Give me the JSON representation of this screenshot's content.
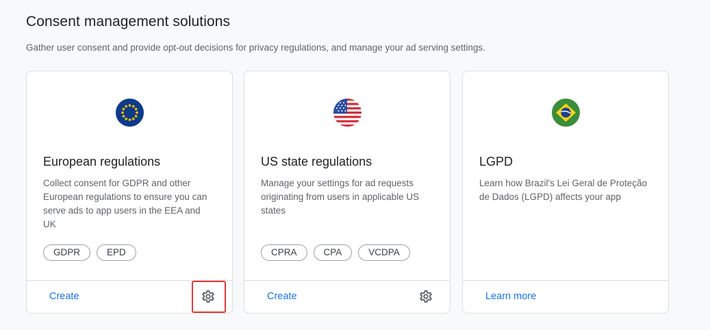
{
  "header": {
    "title": "Consent management solutions",
    "subtitle": "Gather user consent and provide opt-out decisions for privacy regulations, and manage your ad serving settings."
  },
  "cards": [
    {
      "flag_icon": "eu-flag-icon",
      "title": "European regulations",
      "description": "Collect consent for GDPR and other European regulations to ensure you can serve ads to app users in the EEA and UK",
      "chips": [
        "GDPR",
        "EPD"
      ],
      "action_label": "Create",
      "has_settings": true,
      "settings_highlighted": true
    },
    {
      "flag_icon": "us-flag-icon",
      "title": "US state regulations",
      "description": "Manage your settings for ad requests originating from users in applicable US states",
      "chips": [
        "CPRA",
        "CPA",
        "VCDPA"
      ],
      "action_label": "Create",
      "has_settings": true,
      "settings_highlighted": false
    },
    {
      "flag_icon": "brazil-flag-icon",
      "title": "LGPD",
      "description": "Learn how Brazil's Lei Geral de Proteção de Dados (LGPD) affects your app",
      "chips": [],
      "action_label": "Learn more",
      "has_settings": false,
      "settings_highlighted": false
    }
  ],
  "colors": {
    "link": "#1a73e8",
    "highlight": "#e53935",
    "eu_blue": "#0d3b8a",
    "eu_star": "#f5b800",
    "us_red": "#d52b3a",
    "us_blue": "#2b4fa3",
    "br_green": "#3a8d3a",
    "br_yellow": "#f7d117",
    "br_blue": "#1e3f8f"
  }
}
